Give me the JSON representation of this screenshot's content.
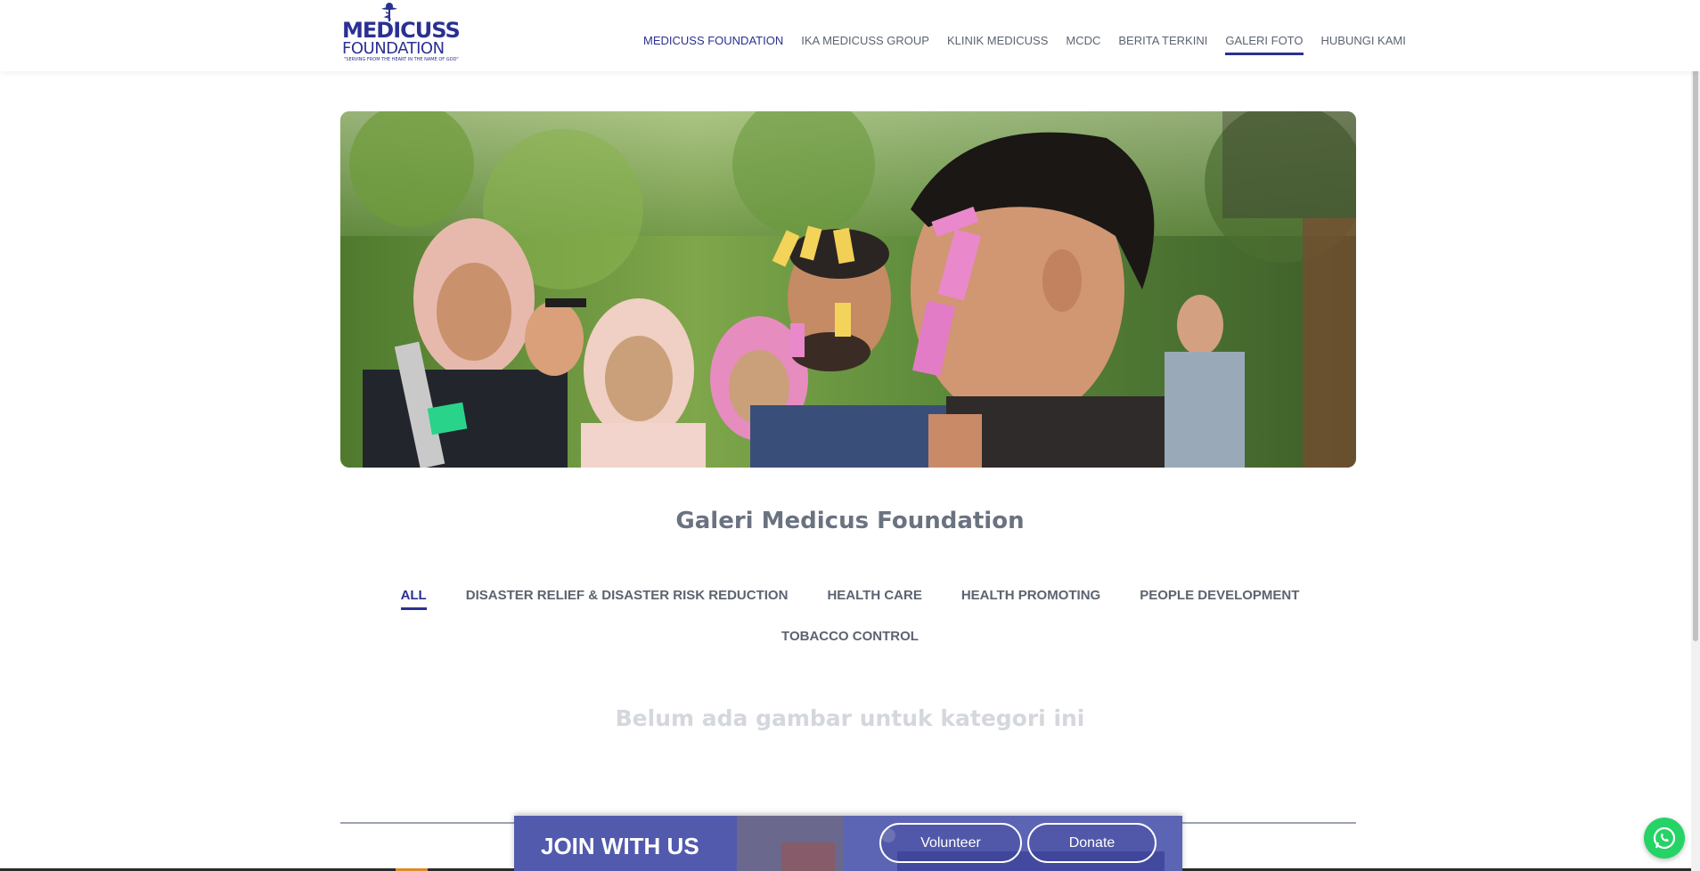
{
  "header": {
    "logo": {
      "line1": "MEDICUSS",
      "line2": "FOUNDATION",
      "tagline": "\"SERVING FROM THE HEART IN THE NAME OF GOD\"",
      "icon": "caduceus-icon"
    },
    "nav": [
      {
        "label": "MEDICUSS FOUNDATION"
      },
      {
        "label": "IKA MEDICUSS GROUP"
      },
      {
        "label": "KLINIK MEDICUSS"
      },
      {
        "label": "MCDC"
      },
      {
        "label": "BERITA TERKINI"
      },
      {
        "label": "GALERI FOTO"
      },
      {
        "label": "HUBUNGI KAMI"
      }
    ],
    "active_nav": "GALERI FOTO"
  },
  "gallery": {
    "title": "Galeri Medicus Foundation",
    "tabs": [
      {
        "label": "ALL"
      },
      {
        "label": "DISASTER RELIEF & DISASTER RISK REDUCTION"
      },
      {
        "label": "HEALTH CARE"
      },
      {
        "label": "HEALTH PROMOTING"
      },
      {
        "label": "PEOPLE DEVELOPMENT"
      },
      {
        "label": "TOBACCO CONTROL"
      }
    ],
    "active_tab": "ALL",
    "empty_message": "Belum ada gambar untuk kategori ini"
  },
  "join_banner": {
    "label": "JOIN WITH US",
    "volunteer_label": "Volunteer",
    "donate_label": "Donate"
  },
  "colors": {
    "brand": "#2a3192",
    "text": "#5b6470",
    "whatsapp": "#25d366"
  }
}
